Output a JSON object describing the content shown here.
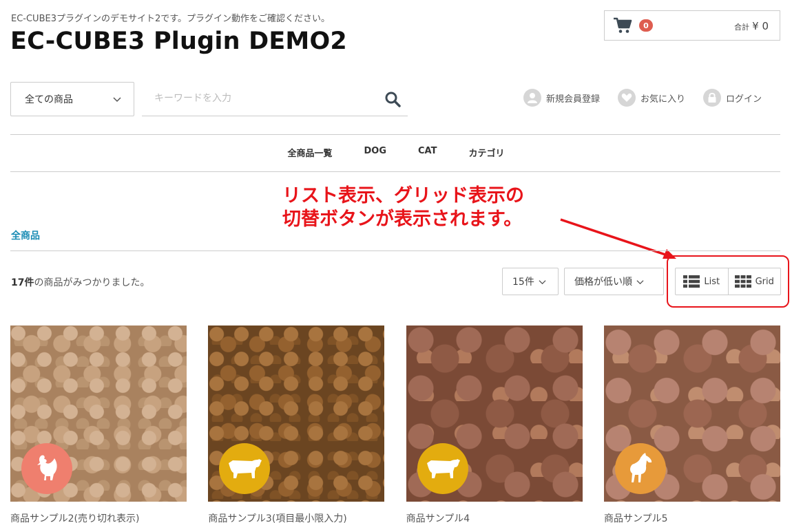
{
  "header": {
    "tagline": "EC-CUBE3プラグインのデモサイト2です。プラグイン動作をご確認ください。",
    "site_title": "EC-CUBE3 Plugin DEMO2",
    "cart": {
      "count": "0",
      "total_label": "合計",
      "total_amount": "¥ 0",
      "icon": "cart-icon"
    },
    "category_select": "全ての商品",
    "search_placeholder": "キーワードを入力",
    "links": [
      {
        "label": "新規会員登録",
        "icon": "user-icon"
      },
      {
        "label": "お気に入り",
        "icon": "heart-icon"
      },
      {
        "label": "ログイン",
        "icon": "lock-icon"
      }
    ]
  },
  "nav": [
    "全商品一覧",
    "DOG",
    "CAT",
    "カテゴリ"
  ],
  "annotation": {
    "line1": "リスト表示、グリッド表示の",
    "line2": "切替ボタンが表示されます。",
    "color": "#e8141a"
  },
  "breadcrumb": "全商品",
  "results": {
    "count": "17件",
    "suffix": "の商品がみつかりました。",
    "per_page": "15件",
    "sort": "価格が低い順",
    "view_list": "List",
    "view_grid": "Grid"
  },
  "products": [
    {
      "name": "商品サンプル2(売り切れ表示)",
      "badge_icon": "chicken-icon",
      "badge_color": "#ef7f6e"
    },
    {
      "name": "商品サンプル3(項目最小限入力)",
      "badge_icon": "cow-icon",
      "badge_color": "#e3ac0f"
    },
    {
      "name": "商品サンプル4",
      "badge_icon": "cow-icon",
      "badge_color": "#e3ac0f"
    },
    {
      "name": "商品サンプル5",
      "badge_icon": "horse-icon",
      "badge_color": "#e79a3a"
    }
  ],
  "colors": {
    "accent_link": "#1a8cb4",
    "badge_red": "#de5d50"
  }
}
